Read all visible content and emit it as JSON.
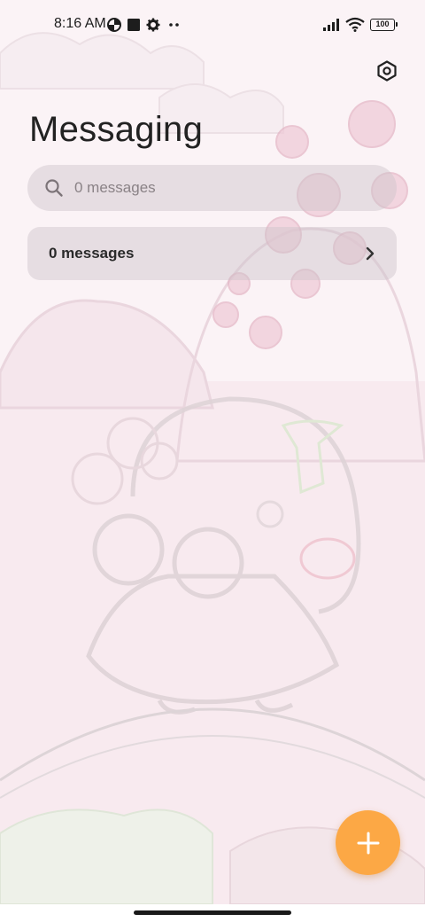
{
  "status_bar": {
    "time": "8:16 AM",
    "battery": "100",
    "icons": [
      "data-saver-icon",
      "square-notification-icon",
      "gear-notification-icon",
      "more-dots-icon",
      "signal-icon",
      "wifi-icon",
      "battery-icon"
    ]
  },
  "header": {
    "title": "Messaging",
    "settings_icon": "settings-hex-icon"
  },
  "search": {
    "placeholder": "0 messages",
    "value": ""
  },
  "summary": {
    "label": "0 messages",
    "icon": "chevron-right-icon"
  },
  "fab": {
    "icon": "plus-icon",
    "color": "#fca845"
  },
  "colors": {
    "accent": "#fca845",
    "background": "#fbf3f6"
  }
}
